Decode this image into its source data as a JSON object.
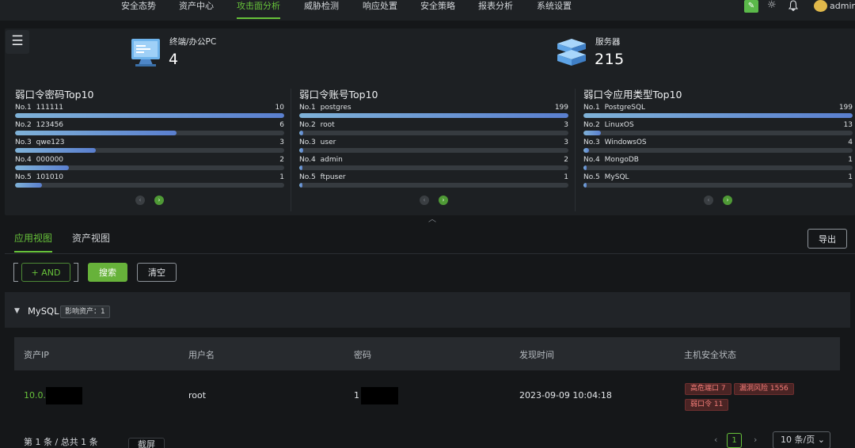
{
  "nav": {
    "items": [
      "安全态势",
      "资产中心",
      "攻击面分析",
      "威胁检测",
      "响应处置",
      "安全策略",
      "报表分析",
      "系统设置"
    ],
    "active_index": 2,
    "user": "admin"
  },
  "stats": {
    "terminal": {
      "label": "终端/办公PC",
      "value": "4"
    },
    "server": {
      "label": "服务器",
      "value": "215"
    }
  },
  "top10": [
    {
      "title": "弱口令密码Top10",
      "rows": [
        {
          "rank": "No.1",
          "name": "111111",
          "count": 10
        },
        {
          "rank": "No.2",
          "name": "123456",
          "count": 6
        },
        {
          "rank": "No.3",
          "name": "qwe123",
          "count": 3
        },
        {
          "rank": "No.4",
          "name": "000000",
          "count": 2
        },
        {
          "rank": "No.5",
          "name": "101010",
          "count": 1
        }
      ]
    },
    {
      "title": "弱口令账号Top10",
      "rows": [
        {
          "rank": "No.1",
          "name": "postgres",
          "count": 199
        },
        {
          "rank": "No.2",
          "name": "root",
          "count": 3
        },
        {
          "rank": "No.3",
          "name": "user",
          "count": 3
        },
        {
          "rank": "No.4",
          "name": "admin",
          "count": 2
        },
        {
          "rank": "No.5",
          "name": "ftpuser",
          "count": 1
        }
      ]
    },
    {
      "title": "弱口令应用类型Top10",
      "rows": [
        {
          "rank": "No.1",
          "name": "PostgreSQL",
          "count": 199
        },
        {
          "rank": "No.2",
          "name": "LinuxOS",
          "count": 13
        },
        {
          "rank": "No.3",
          "name": "WindowsOS",
          "count": 4
        },
        {
          "rank": "No.4",
          "name": "MongoDB",
          "count": 1
        },
        {
          "rank": "No.5",
          "name": "MySQL",
          "count": 1
        }
      ]
    }
  ],
  "tabs": [
    "应用视图",
    "资产视图"
  ],
  "toolbar": {
    "export": "导出",
    "and": "+ AND",
    "search": "搜索",
    "clear": "清空"
  },
  "group": {
    "name": "MySQL",
    "badge": "影响资产：1"
  },
  "table": {
    "headers": [
      "资产IP",
      "用户名",
      "密码",
      "发现时间",
      "主机安全状态"
    ],
    "row": {
      "ip": "10.0.",
      "username": "root",
      "password": "1",
      "time": "2023-09-09 10:04:18",
      "tags": [
        "高危端口 7",
        "漏洞风险 1556",
        "弱口令 11"
      ]
    }
  },
  "footer": {
    "total": "第 1 条 / 总共 1 条",
    "screenshot": "截屏",
    "prev": "‹",
    "page": "1",
    "next": "›",
    "page_size": "10 条/页 ⌄"
  },
  "icons": {
    "menu": "menu-icon",
    "terminal": "monitor-icon",
    "server": "server-icon",
    "theme": "sun-icon",
    "bell": "bell-icon"
  },
  "colors": {
    "accent": "#67c23a",
    "bar_start": "#7fb2d8",
    "bar_end": "#5a7fcf",
    "danger": "#f37c78"
  }
}
